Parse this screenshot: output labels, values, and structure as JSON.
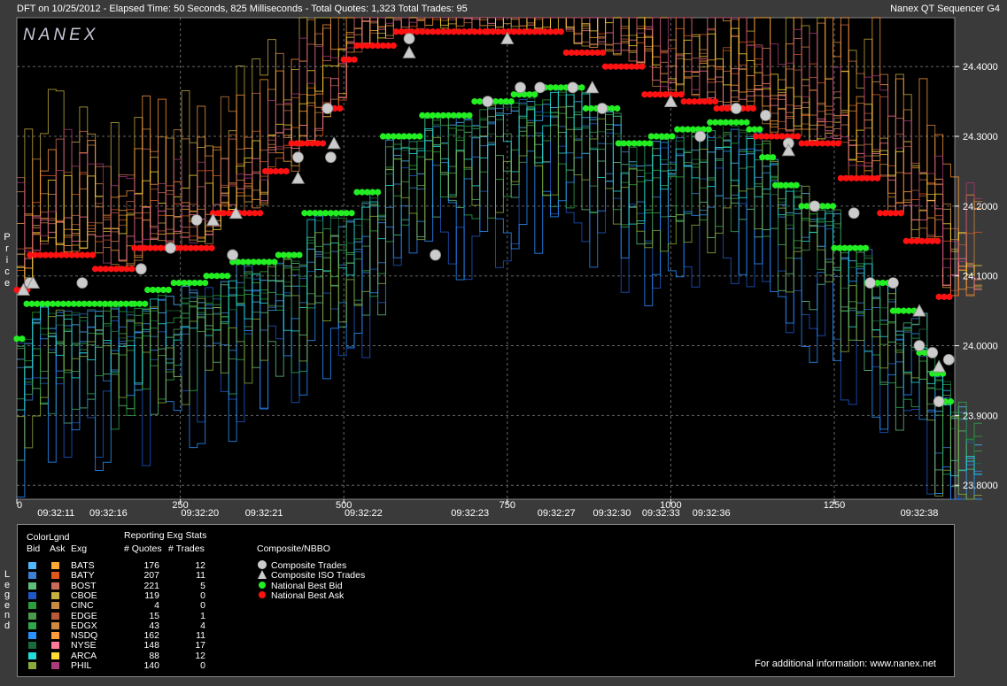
{
  "header": {
    "left": "DFT on 10/25/2012  -  Elapsed Time: 50 Seconds, 825 Milliseconds  -  Total Quotes: 1,323  Total Trades: 95",
    "right": "Nanex QT Sequencer G4"
  },
  "logo": "NANEX",
  "side_labels": {
    "price": [
      "P",
      "r",
      "i",
      "c",
      "e"
    ],
    "legend": [
      "L",
      "e",
      "g",
      "e",
      "n",
      "d"
    ]
  },
  "colors": {
    "bid": "#22ee22",
    "ask": "#ff1111",
    "trade": "#cccccc",
    "plot_bg": "#000000",
    "frame": "#3a3a3a"
  },
  "chart_data": {
    "type": "line",
    "ylim": [
      23.78,
      24.47
    ],
    "xlim": [
      0,
      1420
    ],
    "y_ticks": [
      "23.8000",
      "23.9000",
      "24.0000",
      "24.1000",
      "24.2000",
      "24.3000",
      "24.4000"
    ],
    "y_tick_values": [
      23.8,
      23.9,
      24.0,
      24.1,
      24.2,
      24.3,
      24.4
    ],
    "x_ticks": [
      {
        "v": 0,
        "label": "0"
      },
      {
        "v": 250,
        "label": "250"
      },
      {
        "v": 500,
        "label": "500"
      },
      {
        "v": 750,
        "label": "750"
      },
      {
        "v": 1000,
        "label": "1000"
      },
      {
        "v": 1250,
        "label": "1250"
      }
    ],
    "time_labels": [
      {
        "v": 60,
        "label": "09:32:11"
      },
      {
        "v": 140,
        "label": "09:32:16"
      },
      {
        "v": 280,
        "label": "09:32:20"
      },
      {
        "v": 378,
        "label": "09:32:21"
      },
      {
        "v": 530,
        "label": "09:32:22"
      },
      {
        "v": 693,
        "label": "09:32:23"
      },
      {
        "v": 825,
        "label": "09:32:27"
      },
      {
        "v": 910,
        "label": "09:32:30"
      },
      {
        "v": 985,
        "label": "09:32:33"
      },
      {
        "v": 1062,
        "label": "09:32:36"
      },
      {
        "v": 1380,
        "label": "09:32:38"
      }
    ],
    "nbbo_bid": [
      [
        0,
        24.01
      ],
      [
        15,
        24.06
      ],
      [
        180,
        24.06
      ],
      [
        200,
        24.08
      ],
      [
        240,
        24.09
      ],
      [
        290,
        24.1
      ],
      [
        330,
        24.12
      ],
      [
        400,
        24.13
      ],
      [
        440,
        24.19
      ],
      [
        520,
        24.22
      ],
      [
        560,
        24.3
      ],
      [
        620,
        24.33
      ],
      [
        700,
        24.35
      ],
      [
        760,
        24.36
      ],
      [
        800,
        24.37
      ],
      [
        870,
        24.34
      ],
      [
        920,
        24.29
      ],
      [
        970,
        24.3
      ],
      [
        1010,
        24.31
      ],
      [
        1060,
        24.32
      ],
      [
        1120,
        24.31
      ],
      [
        1140,
        24.27
      ],
      [
        1160,
        24.23
      ],
      [
        1200,
        24.2
      ],
      [
        1250,
        24.14
      ],
      [
        1300,
        24.09
      ],
      [
        1340,
        24.05
      ],
      [
        1380,
        23.99
      ],
      [
        1400,
        23.96
      ],
      [
        1420,
        23.92
      ],
      [
        1440,
        23.89
      ],
      [
        1470,
        23.9
      ]
    ],
    "nbbo_ask": [
      [
        0,
        24.08
      ],
      [
        20,
        24.13
      ],
      [
        120,
        24.11
      ],
      [
        180,
        24.14
      ],
      [
        250,
        24.14
      ],
      [
        300,
        24.19
      ],
      [
        380,
        24.25
      ],
      [
        420,
        24.29
      ],
      [
        470,
        24.34
      ],
      [
        500,
        24.41
      ],
      [
        520,
        24.43
      ],
      [
        580,
        24.45
      ],
      [
        720,
        24.45
      ],
      [
        840,
        24.42
      ],
      [
        900,
        24.4
      ],
      [
        960,
        24.36
      ],
      [
        1020,
        24.35
      ],
      [
        1070,
        24.34
      ],
      [
        1130,
        24.3
      ],
      [
        1200,
        24.29
      ],
      [
        1260,
        24.24
      ],
      [
        1320,
        24.19
      ],
      [
        1360,
        24.15
      ],
      [
        1410,
        24.07
      ],
      [
        1470,
        24.06
      ]
    ],
    "trades": [
      [
        20,
        24.09
      ],
      [
        100,
        24.09
      ],
      [
        190,
        24.11
      ],
      [
        235,
        24.14
      ],
      [
        275,
        24.18
      ],
      [
        330,
        24.13
      ],
      [
        430,
        24.27
      ],
      [
        475,
        24.34
      ],
      [
        480,
        24.27
      ],
      [
        600,
        24.44
      ],
      [
        640,
        24.13
      ],
      [
        720,
        24.35
      ],
      [
        770,
        24.37
      ],
      [
        800,
        24.37
      ],
      [
        850,
        24.37
      ],
      [
        895,
        24.34
      ],
      [
        1045,
        24.3
      ],
      [
        1100,
        24.34
      ],
      [
        1145,
        24.33
      ],
      [
        1180,
        24.29
      ],
      [
        1220,
        24.2
      ],
      [
        1280,
        24.19
      ],
      [
        1305,
        24.09
      ],
      [
        1340,
        24.09
      ],
      [
        1380,
        24.0
      ],
      [
        1400,
        23.99
      ],
      [
        1410,
        23.92
      ],
      [
        1425,
        23.98
      ],
      [
        1445,
        24.05
      ]
    ],
    "iso_trades": [
      [
        10,
        24.08
      ],
      [
        25,
        24.09
      ],
      [
        300,
        24.18
      ],
      [
        335,
        24.19
      ],
      [
        430,
        24.24
      ],
      [
        485,
        24.29
      ],
      [
        600,
        24.42
      ],
      [
        750,
        24.44
      ],
      [
        880,
        24.37
      ],
      [
        1000,
        24.35
      ],
      [
        1180,
        24.28
      ],
      [
        1380,
        24.05
      ],
      [
        1410,
        23.97
      ],
      [
        1430,
        24.04
      ]
    ]
  },
  "legend": {
    "colorlegend": "ColorLgnd",
    "col_bid": "Bid",
    "col_ask": "Ask",
    "col_exg": "Exg",
    "reporting": "Reporting Exg Stats",
    "col_quotes": "# Quotes",
    "col_trades": "# Trades",
    "composite": "Composite/NBBO",
    "exchanges": [
      {
        "name": "BATS",
        "quotes": "176",
        "trades": "12",
        "bid": "#4fb6ff",
        "ask": "#ffaa33"
      },
      {
        "name": "BATY",
        "quotes": "207",
        "trades": "11",
        "bid": "#3d7fd4",
        "ask": "#e05818"
      },
      {
        "name": "BOST",
        "quotes": "221",
        "trades": "5",
        "bid": "#5dbf7a",
        "ask": "#c86a5a"
      },
      {
        "name": "CBOE",
        "quotes": "119",
        "trades": "0",
        "bid": "#1e58c8",
        "ask": "#c8b040"
      },
      {
        "name": "CINC",
        "quotes": "4",
        "trades": "0",
        "bid": "#2aa03c",
        "ask": "#c68a40"
      },
      {
        "name": "EDGE",
        "quotes": "15",
        "trades": "1",
        "bid": "#4a9a4a",
        "ask": "#b85a3a"
      },
      {
        "name": "EDGX",
        "quotes": "43",
        "trades": "4",
        "bid": "#2fa84a",
        "ask": "#d08840"
      },
      {
        "name": "NSDQ",
        "quotes": "162",
        "trades": "11",
        "bid": "#2890ff",
        "ask": "#ff9a3a"
      },
      {
        "name": "NYSE",
        "quotes": "148",
        "trades": "17",
        "bid": "#1a6a3a",
        "ask": "#ff7a9a"
      },
      {
        "name": "ARCA",
        "quotes": "88",
        "trades": "12",
        "bid": "#22dddd",
        "ask": "#ffdd33"
      },
      {
        "name": "PHIL",
        "quotes": "140",
        "trades": "0",
        "bid": "#8aaa3a",
        "ask": "#aa3a7a"
      }
    ],
    "composite_items": [
      {
        "label": "Composite Trades",
        "icon": "circle-icon"
      },
      {
        "label": "Composite ISO Trades",
        "icon": "triangle-icon"
      },
      {
        "label": "National Best Bid",
        "icon": "green-dot-icon"
      },
      {
        "label": "National Best Ask",
        "icon": "red-dot-icon"
      }
    ],
    "info": "For additional information: www.nanex.net"
  }
}
